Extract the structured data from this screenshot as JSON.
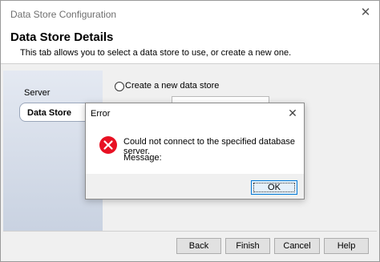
{
  "window": {
    "title": "Data Store Configuration"
  },
  "header": {
    "title": "Data Store Details",
    "subtitle": "This tab allows you to select a data store to use, or create a new one."
  },
  "sidebar": {
    "items": [
      {
        "label": "Server"
      },
      {
        "label": "Data Store",
        "selected": true
      }
    ]
  },
  "content": {
    "radio_create_label": "Create a new data store"
  },
  "footer": {
    "back_label": "Back",
    "finish_label": "Finish",
    "cancel_label": "Cancel",
    "help_label": "Help"
  },
  "error_dialog": {
    "title": "Error",
    "message": "Could not connect to the specified database server.",
    "message_label": "Message:",
    "ok_label": "OK",
    "icon": "error-icon"
  },
  "colors": {
    "error_red": "#e81123",
    "ok_border": "#0078d7"
  }
}
